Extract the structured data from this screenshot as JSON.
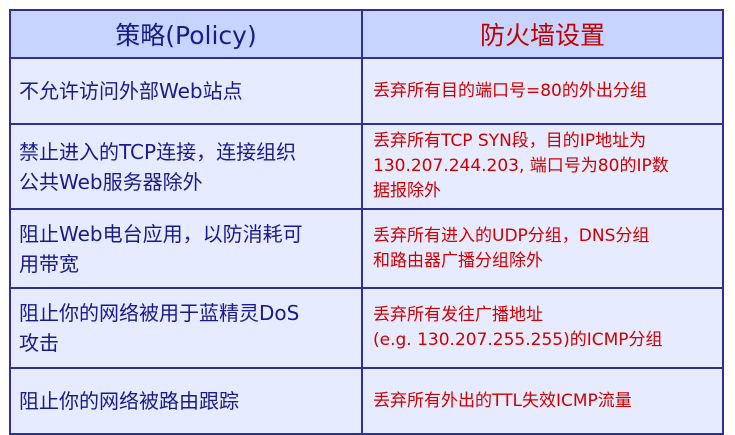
{
  "header": {
    "policy": "策略(Policy)",
    "setting": "防火墙设置"
  },
  "rows": [
    {
      "policy": "不允许访问外部Web站点",
      "setting": "丢弃所有目的端口号=80的外出分组"
    },
    {
      "policy": "禁止进入的TCP连接，连接组织\n公共Web服务器除外",
      "setting": "丢弃所有TCP SYN段，目的IP地址为\n130.207.244.203, 端口号为80的IP数\n据报除外"
    },
    {
      "policy": "阻止Web电台应用，以防消耗可\n用带宽",
      "setting": "丢弃所有进入的UDP分组，DNS分组\n和路由器广播分组除外"
    },
    {
      "policy": "阻止你的网络被用于蓝精灵DoS\n攻击",
      "setting": "丢弃所有发往广播地址\n(e.g. 130.207.255.255)的ICMP分组"
    },
    {
      "policy": "阻止你的网络被路由跟踪",
      "setting": "丢弃所有外出的TTL失效ICMP流量"
    }
  ]
}
